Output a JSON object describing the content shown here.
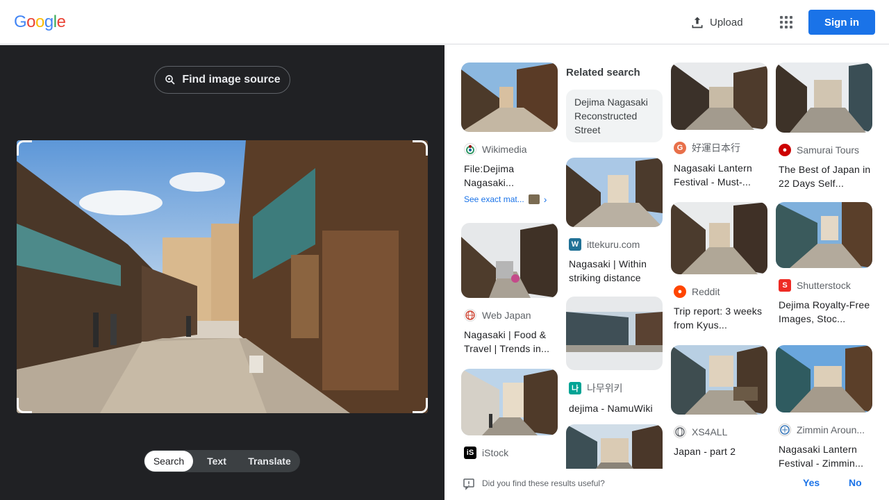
{
  "header": {
    "logo": [
      "G",
      "o",
      "o",
      "g",
      "l",
      "e"
    ],
    "logo_colors": [
      "#4285F4",
      "#EA4335",
      "#FBBC05",
      "#4285F4",
      "#34A853",
      "#EA4335"
    ],
    "upload_label": "Upload",
    "signin_label": "Sign in"
  },
  "left": {
    "find_source_label": "Find image source",
    "modes": [
      "Search",
      "Text",
      "Translate"
    ],
    "active_mode": "Search"
  },
  "related": {
    "title": "Related search",
    "chip": "Dejima Nagasaki Reconstructed Street"
  },
  "results": [
    {
      "source": "Wikimedia",
      "title": "File:Dejima Nagasaki...",
      "icon": "wikimedia-icon",
      "exact_label": "See exact mat..."
    },
    {
      "source": "Web Japan",
      "title": "Nagasaki | Food & Travel | Trends in...",
      "icon": "globe-icon"
    },
    {
      "source": "iStock",
      "title": "",
      "icon": "istock-icon"
    },
    {
      "source": "ittekuru.com",
      "title": "Nagasaki | Within striking distance",
      "icon": "wordpress-icon"
    },
    {
      "source": "나무위키",
      "title": "dejima - NamuWiki",
      "icon": "namuwiki-icon"
    },
    {
      "source": "好運日本行",
      "title": "Nagasaki Lantern Festival - Must-...",
      "icon": "site-icon"
    },
    {
      "source": "Reddit",
      "title": "Trip report: 3 weeks from Kyus...",
      "icon": "reddit-icon"
    },
    {
      "source": "XS4ALL",
      "title": "Japan - part 2",
      "icon": "globe-icon"
    },
    {
      "source": "Samurai Tours",
      "title": "The Best of Japan in 22 Days Self...",
      "icon": "samurai-icon"
    },
    {
      "source": "Shutterstock",
      "title": "Dejima Royalty-Free Images, Stoc...",
      "icon": "shutterstock-icon"
    },
    {
      "source": "Zimmin Aroun...",
      "title": "Nagasaki Lantern Festival - Zimmin...",
      "icon": "zimmin-icon"
    }
  ],
  "feedback": {
    "question": "Did you find these results useful?",
    "yes": "Yes",
    "no": "No"
  }
}
